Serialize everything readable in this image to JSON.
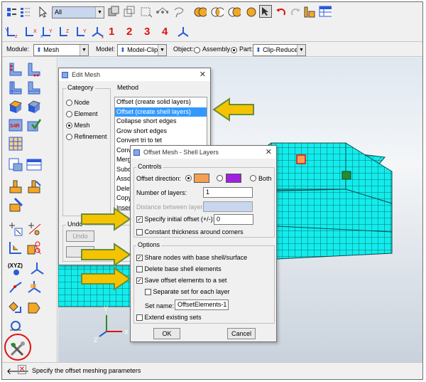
{
  "toolbar": {
    "filter_value": "All",
    "view_numbers": [
      "1",
      "2",
      "3",
      "4"
    ]
  },
  "context_bar": {
    "module_label": "Module:",
    "module_value": "Mesh",
    "model_label": "Model:",
    "model_value": "Model-Clip",
    "object_label": "Object:",
    "assembly_label": "Assembly",
    "part_label": "Part:",
    "part_value": "Clip-Reduced"
  },
  "edit_mesh": {
    "title": "Edit Mesh",
    "category_label": "Category",
    "categories": [
      "Node",
      "Element",
      "Mesh",
      "Refinement"
    ],
    "selected_category": "Mesh",
    "method_label": "Method",
    "methods": [
      "Offset (create solid layers)",
      "Offset (create shell layers)",
      "Collapse short edges",
      "Grow short edges",
      "Convert tri to tet",
      "Conv",
      "Merg",
      "Subd",
      "Asso",
      "Delet",
      "Copy",
      "Insert"
    ],
    "selected_method": "Offset (create shell layers)",
    "undo_label": "Undo",
    "undo_button": "Undo"
  },
  "offset_dialog": {
    "title": "Offset Mesh - Shell Layers",
    "controls_label": "Controls",
    "offset_direction_label": "Offset direction:",
    "both_label": "Both",
    "layers_label": "Number of layers:",
    "layers_value": "1",
    "distance_label": "Distance between layers:",
    "initial_offset_label": "Specify initial offset (+/-):",
    "initial_offset_value": "0",
    "constant_thickness_label": "Constant thickness around corners",
    "options_label": "Options",
    "share_nodes_label": "Share nodes with base shell/surface",
    "delete_base_label": "Delete base shell elements",
    "save_offset_label": "Save offset elements to a set",
    "separate_set_label": "Separate set for each layer",
    "set_name_label": "Set name:",
    "set_name_value": "OffsetElements-1",
    "extend_label": "Extend existing sets",
    "ok_label": "OK",
    "cancel_label": "Cancel"
  },
  "prompt": {
    "text": "Specify the offset meshing parameters"
  },
  "triad": {
    "y_label": "Y",
    "z_label": "Z",
    "x_label": "X"
  },
  "colors": {
    "mesh_fill": "#13ecec",
    "mesh_line": "#0a4c4c",
    "arrow_fill": "#f5c400",
    "arrow_stroke": "#6a8d3a",
    "highlight_red": "#e01010",
    "swatch_orange": "#f5a050",
    "swatch_purple": "#a020e0",
    "selection_blue": "#3399ff",
    "view_number_red": "#e01010"
  }
}
